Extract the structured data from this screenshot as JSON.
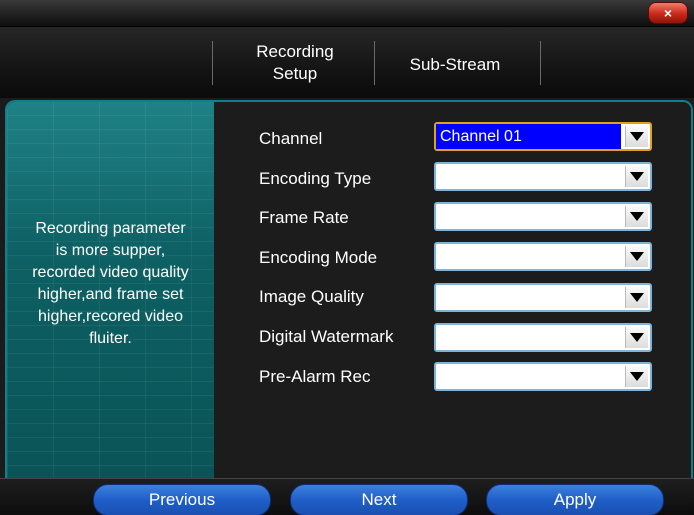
{
  "window": {
    "close_label": "×"
  },
  "tabs": [
    {
      "label_line1": "Recording",
      "label_line2": "Setup"
    },
    {
      "label": "Sub-Stream"
    }
  ],
  "description": "Recording parameter is more supper, recorded video quality higher,and frame set higher,recored video fluiter.",
  "description_lines": [
    "Recording parameter",
    "is more supper,",
    "recorded video quality",
    "higher,and frame set",
    "higher,recored video",
    "fluiter."
  ],
  "fields": [
    {
      "label": "Channel",
      "value": "Channel 01"
    },
    {
      "label": "Encoding Type",
      "value": ""
    },
    {
      "label": "Frame Rate",
      "value": ""
    },
    {
      "label": "Encoding Mode",
      "value": ""
    },
    {
      "label": "Image Quality",
      "value": ""
    },
    {
      "label": "Digital Watermark",
      "value": ""
    },
    {
      "label": "Pre-Alarm Rec",
      "value": ""
    }
  ],
  "buttons": {
    "previous": "Previous",
    "next": "Next",
    "apply": "Apply"
  }
}
